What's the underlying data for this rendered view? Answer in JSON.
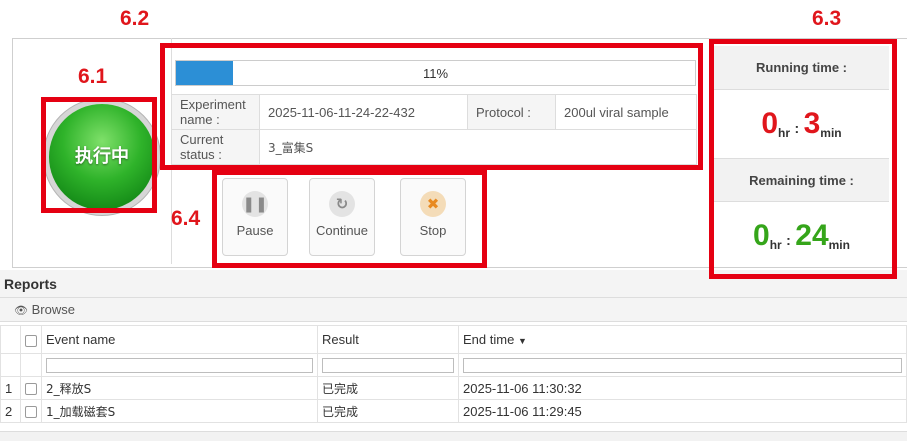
{
  "annotations": {
    "a61": "6.1",
    "a62": "6.2",
    "a63": "6.3",
    "a64": "6.4"
  },
  "lamp": {
    "text": "执行中",
    "color": "#2fb32a"
  },
  "progress": {
    "percent_label": "11%",
    "value": 0.11
  },
  "info": {
    "experiment_name_label": "Experiment name :",
    "experiment_name_value": "2025-11-06-11-24-22-432",
    "protocol_label": "Protocol :",
    "protocol_value": "200ul viral sample",
    "current_status_label": "Current status :",
    "current_status_value": "3_富集S"
  },
  "running": {
    "label": "Running time :",
    "hours": "0",
    "hr_unit": "hr",
    "colon": ":",
    "minutes": "3",
    "min_unit": "min",
    "color": "#e0161c"
  },
  "remaining": {
    "label": "Remaining time :",
    "hours": "0",
    "hr_unit": "hr",
    "colon": ":",
    "minutes": "24",
    "min_unit": "min",
    "color": "#35a51a"
  },
  "controls": {
    "pause_label": "Pause",
    "pause_icon": "pause-icon",
    "continue_label": "Continue",
    "continue_icon": "refresh-icon",
    "stop_label": "Stop",
    "stop_icon": "close-icon"
  },
  "reports": {
    "title": "Reports",
    "browse_label": "Browse",
    "columns": {
      "event_name": "Event name",
      "result": "Result",
      "end_time": "End time"
    },
    "rows": [
      {
        "index": "1",
        "event_name": "2_释放S",
        "result": "已完成",
        "end_time": "2025-11-06 11:30:32"
      },
      {
        "index": "2",
        "event_name": "1_加载磁套S",
        "result": "已完成",
        "end_time": "2025-11-06 11:29:45"
      }
    ]
  }
}
